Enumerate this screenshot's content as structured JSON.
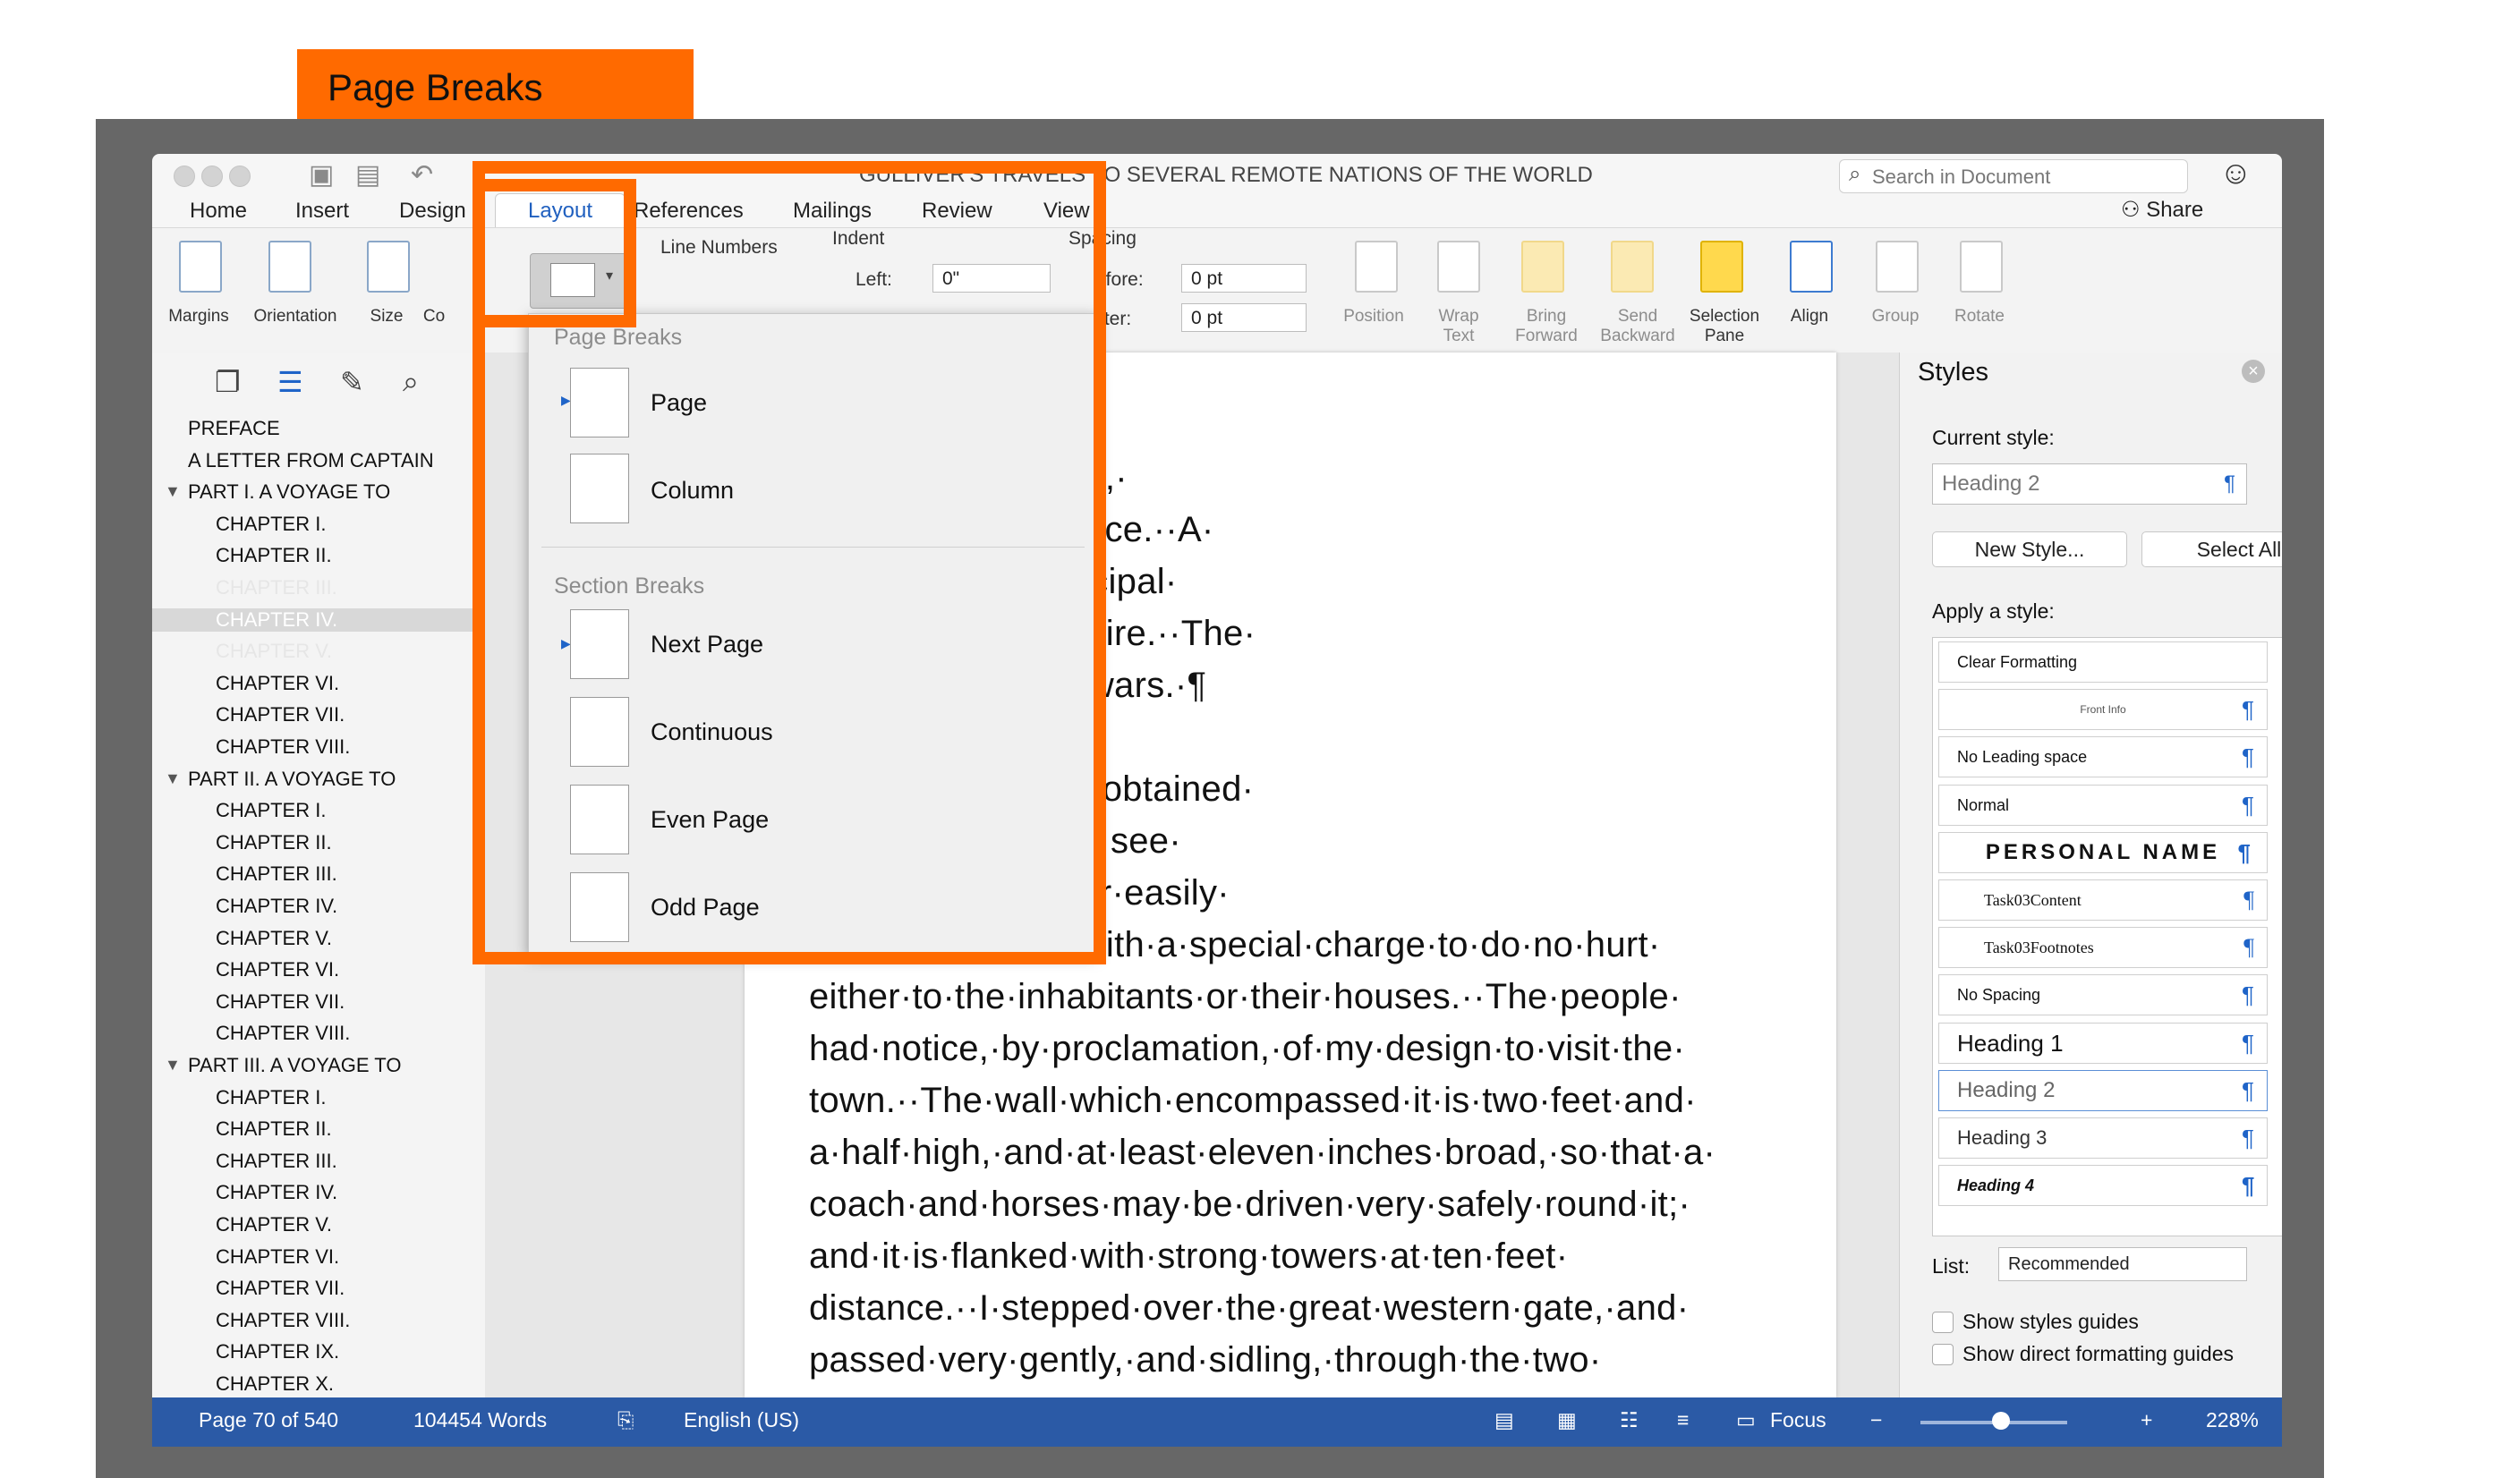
{
  "label": "Page Breaks",
  "titlebar": {
    "doc_title": "GULLIVER'S TRAVELS   TO SEVERAL REMOTE NATIONS OF THE WORLD",
    "search_placeholder": "Search in Document",
    "share": "Share"
  },
  "tabs": [
    "Home",
    "Insert",
    "Design",
    "Layout",
    "References",
    "Mailings",
    "Review",
    "View"
  ],
  "active_tab": "Layout",
  "ribbon": {
    "margins": "Margins",
    "orientation": "Orientation",
    "size": "Size",
    "columns": "Co",
    "line_numbers": "Line Numbers",
    "indent": "Indent",
    "left_label": "Left:",
    "left_value": "0\"",
    "spacing": "Spacing",
    "before_label": "efore:",
    "before_value": "0 pt",
    "after_label": "fter:",
    "after_value": "0 pt",
    "position": "Position",
    "wrap_text": "Wrap Text",
    "bring_forward": "Bring Forward",
    "send_backward": "Send Backward",
    "selection_pane": "Selection Pane",
    "align": "Align",
    "group": "Group",
    "rotate": "Rotate"
  },
  "nav_items": [
    {
      "text": "PREFACE",
      "level": 0
    },
    {
      "text": "A LETTER FROM CAPTAIN",
      "level": 0
    },
    {
      "text": "PART I.  A VOYAGE TO",
      "level": 0
    },
    {
      "text": "CHAPTER I.",
      "level": 1
    },
    {
      "text": "CHAPTER II.",
      "level": 1
    },
    {
      "text": "CHAPTER III.",
      "level": 1
    },
    {
      "text": "CHAPTER IV.",
      "level": 1
    },
    {
      "text": "CHAPTER V.",
      "level": 1
    },
    {
      "text": "CHAPTER VI.",
      "level": 1
    },
    {
      "text": "CHAPTER VII.",
      "level": 1
    },
    {
      "text": "CHAPTER VIII.",
      "level": 1
    },
    {
      "text": "PART II.  A VOYAGE TO",
      "level": 0
    },
    {
      "text": "CHAPTER I.",
      "level": 1
    },
    {
      "text": "CHAPTER II.",
      "level": 1
    },
    {
      "text": "CHAPTER III.",
      "level": 1
    },
    {
      "text": "CHAPTER IV.",
      "level": 1
    },
    {
      "text": "CHAPTER V.",
      "level": 1
    },
    {
      "text": "CHAPTER VI.",
      "level": 1
    },
    {
      "text": "CHAPTER VII.",
      "level": 1
    },
    {
      "text": "CHAPTER VIII.",
      "level": 1
    },
    {
      "text": "PART III.  A VOYAGE TO",
      "level": 0
    },
    {
      "text": "CHAPTER I.",
      "level": 1
    },
    {
      "text": "CHAPTER II.",
      "level": 1
    },
    {
      "text": "CHAPTER III.",
      "level": 1
    },
    {
      "text": "CHAPTER IV.",
      "level": 1
    },
    {
      "text": "CHAPTER V.",
      "level": 1
    },
    {
      "text": "CHAPTER VI.",
      "level": 1
    },
    {
      "text": "CHAPTER VII.",
      "level": 1
    },
    {
      "text": "CHAPTER VIII.",
      "level": 1
    },
    {
      "text": "CHAPTER IX.",
      "level": 1
    },
    {
      "text": "CHAPTER X.",
      "level": 1
    }
  ],
  "document_lines": [
    "etropolis·of·Lilliput,·",
    "he·emperor’s·palace.··A·",
    "author·and·a·principal·",
    "affairs·of·that·empire.··The·",
    "e·emperor·in·his·wars.·¶",
    "",
    "made,·after·I·had·obtained·",
    "nt·have·license·to·see·",
    "which·the·emperor·easily·",
    "granted·me,·but·with·a·special·charge·to·do·no·hurt·",
    "either·to·the·inhabitants·or·their·houses.··The·people·",
    "had·notice,·by·proclamation,·of·my·design·to·visit·the·",
    "town.··The·wall·which·encompassed·it·is·two·feet·and·",
    "a·half·high,·and·at·least·eleven·inches·broad,·so·that·a·",
    "coach·and·horses·may·be·driven·very·safely·round·it;·",
    "and·it·is·flanked·with·strong·towers·at·ten·feet·",
    "distance.··I·stepped·over·the·great·western·gate,·and·",
    "passed·very·gently,·and·sidling,·through·the·two·"
  ],
  "breaks_menu": {
    "page_breaks_heading": "Page Breaks",
    "page": "Page",
    "column": "Column",
    "section_breaks_heading": "Section Breaks",
    "next_page": "Next Page",
    "continuous": "Continuous",
    "even_page": "Even Page",
    "odd_page": "Odd Page"
  },
  "styles_pane": {
    "title": "Styles",
    "current_style_label": "Current style:",
    "current_style": "Heading 2",
    "new_style": "New Style...",
    "select_all": "Select All",
    "apply_label": "Apply a style:",
    "styles": [
      "Clear Formatting",
      "Front Info",
      "No Leading space",
      "Normal",
      "PERSONAL NAME",
      "Task03Content",
      "Task03Footnotes",
      "No Spacing",
      "Heading 1",
      "Heading 2",
      "Heading 3",
      "Heading 4"
    ],
    "list_label": "List:",
    "list_value": "Recommended",
    "show_styles_guides": "Show styles guides",
    "show_direct_formatting": "Show direct formatting guides"
  },
  "status": {
    "page": "Page 70 of 540",
    "words": "104454 Words",
    "language": "English (US)",
    "focus": "Focus",
    "zoom": "228%"
  },
  "colors": {
    "accent": "#ff6a00",
    "status_bar": "#2b5aa6",
    "link_blue": "#1f64c8"
  }
}
